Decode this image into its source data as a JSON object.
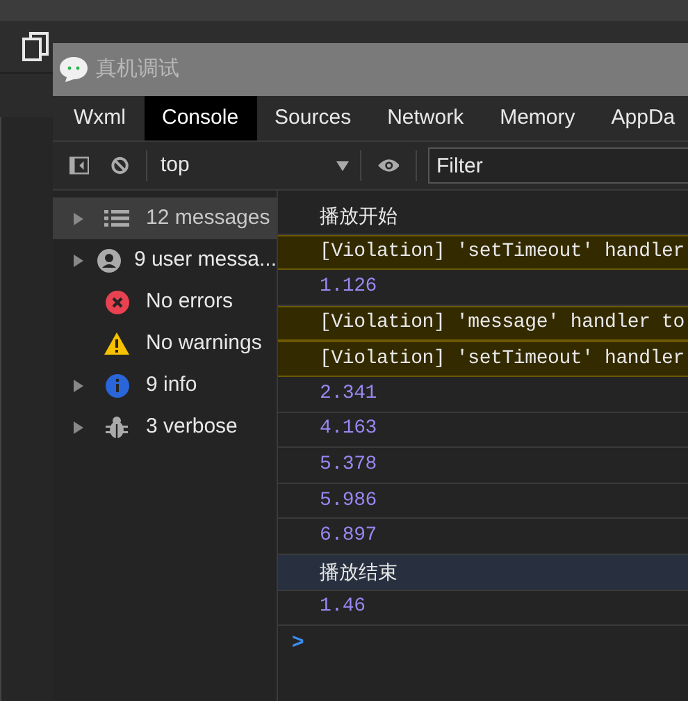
{
  "window": {
    "title": "真机调试"
  },
  "tabs": [
    {
      "label": "Wxml",
      "selected": false
    },
    {
      "label": "Console",
      "selected": true
    },
    {
      "label": "Sources",
      "selected": false
    },
    {
      "label": "Network",
      "selected": false
    },
    {
      "label": "Memory",
      "selected": false
    },
    {
      "label": "AppDa",
      "selected": false
    }
  ],
  "toolbar": {
    "context": "top",
    "filter": {
      "placeholder": "Filter"
    }
  },
  "sidebar": {
    "items": [
      {
        "kind": "list",
        "label": "12 messages",
        "expandable": true,
        "selected": true
      },
      {
        "kind": "user",
        "label": "9 user messa...",
        "expandable": true,
        "selected": false
      },
      {
        "kind": "error",
        "label": "No errors",
        "expandable": false,
        "selected": false
      },
      {
        "kind": "warning",
        "label": "No warnings",
        "expandable": false,
        "selected": false
      },
      {
        "kind": "info",
        "label": "9 info",
        "expandable": true,
        "selected": false
      },
      {
        "kind": "verbose",
        "label": "3 verbose",
        "expandable": true,
        "selected": false
      }
    ]
  },
  "console": {
    "rows": [
      {
        "kind": "text",
        "text": "播放开始",
        "selected": false
      },
      {
        "kind": "violation",
        "text": "[Violation] 'setTimeout' handler",
        "selected": false
      },
      {
        "kind": "number",
        "text": "1.126",
        "selected": false
      },
      {
        "kind": "violation",
        "text": "[Violation] 'message' handler to",
        "selected": false
      },
      {
        "kind": "violation",
        "text": "[Violation] 'setTimeout' handler",
        "selected": false
      },
      {
        "kind": "number",
        "text": "2.341",
        "selected": false
      },
      {
        "kind": "number",
        "text": "4.163",
        "selected": false
      },
      {
        "kind": "number",
        "text": "5.378",
        "selected": false
      },
      {
        "kind": "number",
        "text": "5.986",
        "selected": false
      },
      {
        "kind": "number",
        "text": "6.897",
        "selected": false
      },
      {
        "kind": "text",
        "text": "播放结束",
        "selected": true
      },
      {
        "kind": "number",
        "text": "1.46",
        "selected": false
      }
    ],
    "prompt": ">"
  }
}
